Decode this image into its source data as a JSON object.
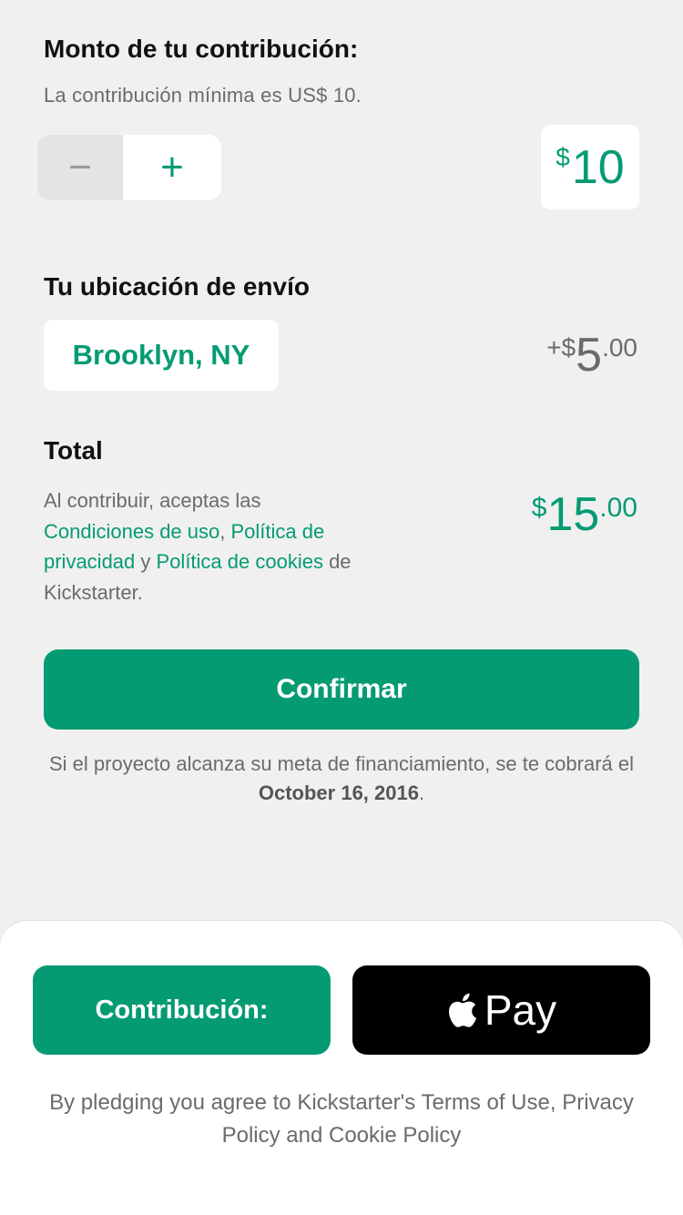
{
  "contribution": {
    "heading": "Monto de tu contribución:",
    "minimum_note": "La contribución mínima es US$ 10.",
    "stepper": {
      "minus": "−",
      "plus": "+"
    },
    "amount_currency": "$",
    "amount_value": "10"
  },
  "shipping": {
    "heading": "Tu ubicación de envío",
    "location": "Brooklyn, NY",
    "price_prefix": "+$",
    "price_whole": "5",
    "price_cents": ".00"
  },
  "total": {
    "heading": "Total",
    "price_prefix": "$",
    "price_whole": "15",
    "price_cents": ".00",
    "legal": {
      "intro": "Al contribuir, aceptas las ",
      "terms": "Condiciones de uso",
      "comma": ", ",
      "privacy": "Política de privacidad",
      "and": " y ",
      "cookies": "Política de cookies",
      "outro": " de Kickstarter."
    }
  },
  "confirm_button": "Confirmar",
  "charge_note": {
    "text": "Si el proyecto alcanza su meta de financiamiento, se te cobrará el ",
    "date": "October 16, 2016",
    "end": "."
  },
  "bottom": {
    "pledge_button": "Contribución:",
    "apple_pay_label": "Pay",
    "legal": "By pledging you agree to Kickstarter's Terms of Use, Privacy Policy and Cookie Policy"
  },
  "colors": {
    "accent": "#049b73",
    "background": "#f0f0f0",
    "muted_text": "#6b6b6b"
  }
}
